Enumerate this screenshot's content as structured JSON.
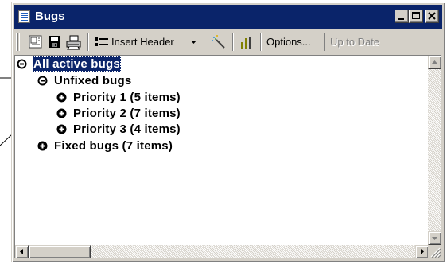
{
  "window": {
    "title": "Bugs",
    "controls": {
      "minimize": "minimize-icon",
      "maximize": "maximize-icon",
      "close": "close-icon"
    }
  },
  "toolbar": {
    "buttons": [
      {
        "name": "properties-icon"
      },
      {
        "name": "save-icon"
      },
      {
        "name": "print-icon"
      }
    ],
    "insert_header_label": "Insert Header",
    "options_label": "Options...",
    "up_to_date_label": "Up to Date"
  },
  "tree": [
    {
      "label": "All active bugs",
      "level": 0,
      "expanded": true,
      "selected": true
    },
    {
      "label": "Unfixed bugs",
      "level": 1,
      "expanded": true,
      "selected": false
    },
    {
      "label": "Priority 1 (5 items)",
      "level": 2,
      "expanded": false,
      "selected": false
    },
    {
      "label": "Priority 2 (7 items)",
      "level": 2,
      "expanded": false,
      "selected": false
    },
    {
      "label": "Priority 3 (4 items)",
      "level": 2,
      "expanded": false,
      "selected": false
    },
    {
      "label": "Fixed bugs (7 items)",
      "level": 1,
      "expanded": false,
      "selected": false
    }
  ],
  "colors": {
    "selection": "#0a246a",
    "titlebar": "#0a246a",
    "face": "#d4d0c8"
  }
}
